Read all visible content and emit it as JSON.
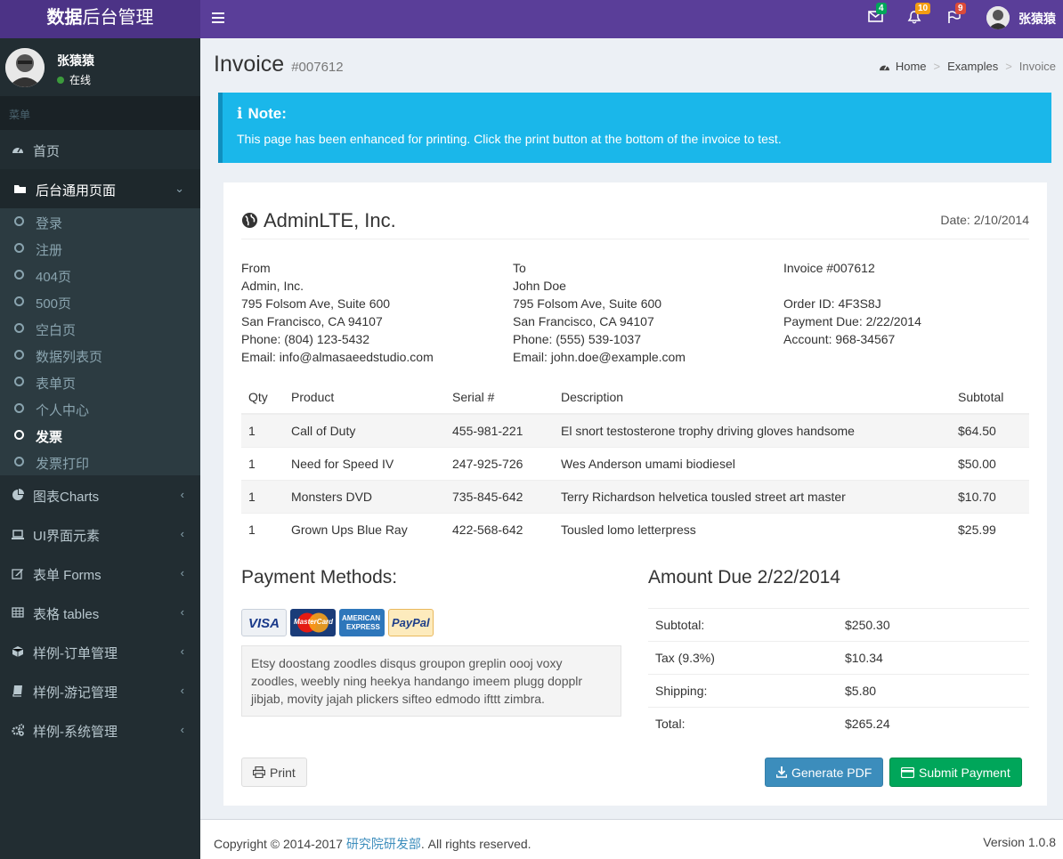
{
  "brand": {
    "bold": "数据",
    "rest": "后台管理"
  },
  "topbar": {
    "mail_badge": "4",
    "bell_badge": "10",
    "flag_badge": "9",
    "colors": {
      "mail": "#00a65a",
      "bell": "#f39c12",
      "flag": "#dd4b39"
    },
    "user_name": "张猿猿"
  },
  "sidebar": {
    "user_name": "张猿猿",
    "status": "在线",
    "menu_header": "菜单",
    "items": [
      {
        "label": "首页",
        "icon": "dashboard-icon"
      },
      {
        "label": "后台通用页面",
        "icon": "folder-icon"
      },
      {
        "label": "图表Charts",
        "icon": "pie-chart-icon"
      },
      {
        "label": "UI界面元素",
        "icon": "laptop-icon"
      },
      {
        "label": "表单 Forms",
        "icon": "edit-icon"
      },
      {
        "label": "表格 tables",
        "icon": "table-icon"
      },
      {
        "label": "样例-订单管理",
        "icon": "cube-icon"
      },
      {
        "label": "样例-游记管理",
        "icon": "book-icon"
      },
      {
        "label": "样例-系统管理",
        "icon": "cogs-icon"
      }
    ],
    "subitems": [
      "登录",
      "注册",
      "404页",
      "500页",
      "空白页",
      "数据列表页",
      "表单页",
      "个人中心",
      "发票",
      "发票打印"
    ]
  },
  "header": {
    "title": "Invoice",
    "subtitle": "#007612"
  },
  "breadcrumb": {
    "home": "Home",
    "examples": "Examples",
    "current": "Invoice"
  },
  "callout": {
    "title": "Note:",
    "text": "This page has been enhanced for printing. Click the print button at the bottom of the invoice to test."
  },
  "invoice": {
    "company": "AdminLTE, Inc.",
    "date": "Date: 2/10/2014",
    "from": [
      "From",
      "Admin, Inc.",
      "795 Folsom Ave, Suite 600",
      "San Francisco, CA 94107",
      "Phone: (804) 123-5432",
      "Email: info@almasaeedstudio.com"
    ],
    "to": [
      "To",
      "John Doe",
      "795 Folsom Ave, Suite 600",
      "San Francisco, CA 94107",
      "Phone: (555) 539-1037",
      "Email: john.doe@example.com"
    ],
    "meta": [
      "Invoice #007612",
      "",
      "Order ID: 4F3S8J",
      "Payment Due: 2/22/2014",
      "Account: 968-34567"
    ],
    "columns": [
      "Qty",
      "Product",
      "Serial #",
      "Description",
      "Subtotal"
    ],
    "rows": [
      [
        "1",
        "Call of Duty",
        "455-981-221",
        "El snort testosterone trophy driving gloves handsome",
        "$64.50"
      ],
      [
        "1",
        "Need for Speed IV",
        "247-925-726",
        "Wes Anderson umami biodiesel",
        "$50.00"
      ],
      [
        "1",
        "Monsters DVD",
        "735-845-642",
        "Terry Richardson helvetica tousled street art master",
        "$10.70"
      ],
      [
        "1",
        "Grown Ups Blue Ray",
        "422-568-642",
        "Tousled lomo letterpress",
        "$25.99"
      ]
    ],
    "payment_title": "Payment Methods:",
    "cards": {
      "visa": "VISA",
      "mastercard": "MasterCard",
      "amex_1": "AMERICAN",
      "amex_2": "EXPRESS",
      "paypal": "PayPal"
    },
    "note": "Etsy doostang zoodles disqus groupon greplin oooj voxy zoodles, weebly ning heekya handango imeem plugg dopplr jibjab, movity jajah plickers sifteo edmodo ifttt zimbra.",
    "amount_title": "Amount Due 2/22/2014",
    "totals": [
      [
        "Subtotal:",
        "$250.30"
      ],
      [
        "Tax (9.3%)",
        "$10.34"
      ],
      [
        "Shipping:",
        "$5.80"
      ],
      [
        "Total:",
        "$265.24"
      ]
    ],
    "buttons": {
      "print": "Print",
      "pdf": "Generate PDF",
      "pay": "Submit Payment"
    }
  },
  "footer": {
    "copy_prefix": "Copyright © 2014-2017 ",
    "org": "研究院研发部",
    "copy_suffix": ". All rights reserved.",
    "version": "Version 1.0.8"
  }
}
